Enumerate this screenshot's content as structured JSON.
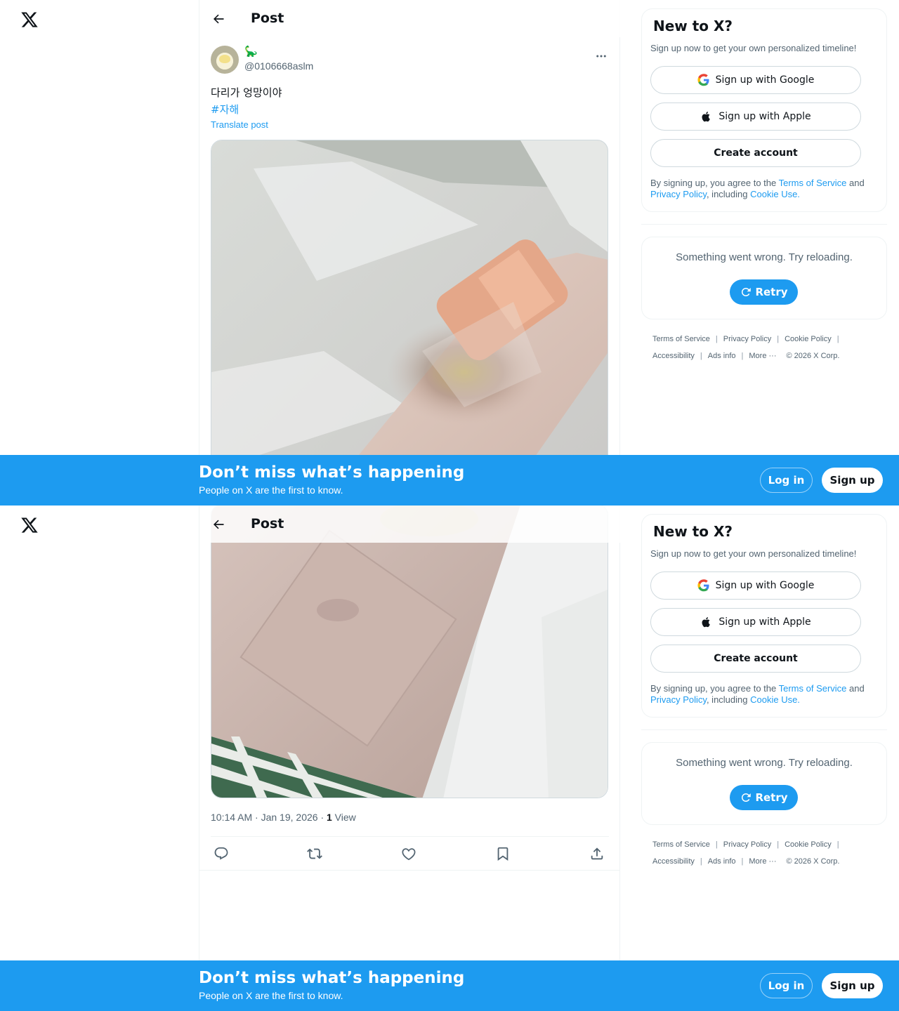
{
  "app": {
    "logo_icon": "x-logo-icon"
  },
  "header": {
    "title": "Post",
    "back_icon": "arrow-left-icon"
  },
  "post": {
    "display_name": "🦕",
    "handle": "@0106668aslm",
    "text": "다리가 엉망이야",
    "hashtag": "#자해",
    "translate_label": "Translate post",
    "media_alt": "Photo of a bruised forearm with an adhesive bandage and a square patch",
    "time": "10:14 AM · Jan 19, 2026 · ",
    "views_count": "1",
    "views_label": " View",
    "actions": [
      "reply-icon",
      "repost-icon",
      "like-icon",
      "bookmark-icon",
      "share-icon"
    ]
  },
  "sidebar": {
    "signup": {
      "title": "New to X?",
      "subtitle": "Sign up now to get your own personalized timeline!",
      "google_label": "Sign up with Google",
      "apple_label": "Sign up with Apple",
      "create_label": "Create account",
      "legal_prefix": "By signing up, you agree to the ",
      "terms_link": "Terms of Service",
      "legal_and": " and ",
      "privacy_link": "Privacy Policy",
      "legal_including": ", including ",
      "cookie_link": "Cookie Use."
    },
    "error": {
      "message": "Something went wrong. Try reloading.",
      "retry_label": "Retry"
    },
    "footer": {
      "terms": "Terms of Service",
      "privacy": "Privacy Policy",
      "cookie": "Cookie Policy",
      "accessibility": "Accessibility",
      "ads": "Ads info",
      "more": "More ···",
      "copyright": "© 2026 X Corp."
    }
  },
  "banner": {
    "title": "Don’t miss what’s happening",
    "subtitle": "People on X are the first to know.",
    "login_label": "Log in",
    "signup_label": "Sign up"
  },
  "colors": {
    "accent": "#1d9bf0",
    "text": "#0f1419",
    "muted": "#536471",
    "border": "#eff3f4"
  }
}
